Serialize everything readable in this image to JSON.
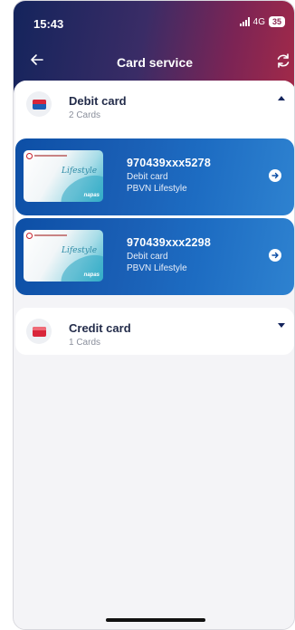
{
  "status": {
    "time": "15:43",
    "network": "4G",
    "battery": "35"
  },
  "header": {
    "title": "Card service",
    "back_icon": "arrow-left-icon",
    "refresh_icon": "refresh-icon"
  },
  "sections": [
    {
      "title": "Debit card",
      "count": "2 Cards",
      "expanded": true,
      "icon_color": "#1d5fb5",
      "cards": [
        {
          "number": "970439xxx5278",
          "type": "Debit card",
          "product": "PBVN Lifestyle",
          "thumb_script": "Lifestyle",
          "thumb_network": "napas"
        },
        {
          "number": "970439xxx2298",
          "type": "Debit card",
          "product": "PBVN Lifestyle",
          "thumb_script": "Lifestyle",
          "thumb_network": "napas"
        }
      ]
    },
    {
      "title": "Credit card",
      "count": "1 Cards",
      "expanded": false,
      "icon_color": "#d9263a"
    }
  ],
  "colors": {
    "header_start": "#14245c",
    "header_end": "#a52a48",
    "card_blue": "#1a5fb5"
  }
}
